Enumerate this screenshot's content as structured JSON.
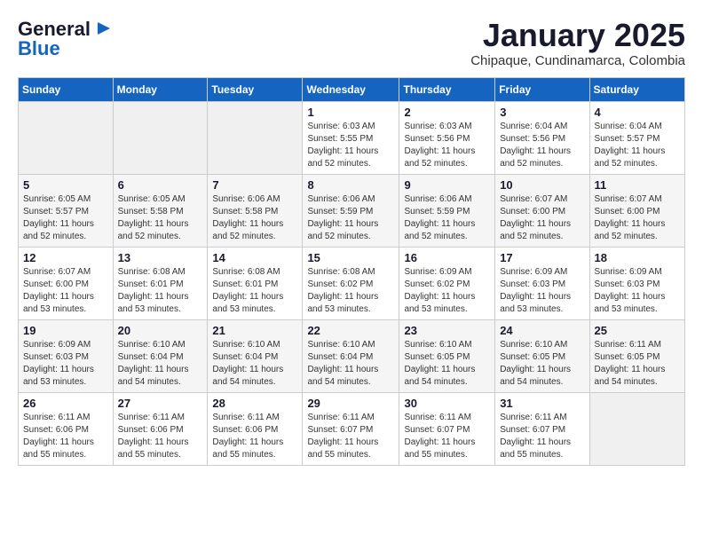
{
  "logo": {
    "general": "General",
    "blue": "Blue"
  },
  "header": {
    "month": "January 2025",
    "location": "Chipaque, Cundinamarca, Colombia"
  },
  "weekdays": [
    "Sunday",
    "Monday",
    "Tuesday",
    "Wednesday",
    "Thursday",
    "Friday",
    "Saturday"
  ],
  "weeks": [
    [
      {
        "day": "",
        "info": ""
      },
      {
        "day": "",
        "info": ""
      },
      {
        "day": "",
        "info": ""
      },
      {
        "day": "1",
        "info": "Sunrise: 6:03 AM\nSunset: 5:55 PM\nDaylight: 11 hours\nand 52 minutes."
      },
      {
        "day": "2",
        "info": "Sunrise: 6:03 AM\nSunset: 5:56 PM\nDaylight: 11 hours\nand 52 minutes."
      },
      {
        "day": "3",
        "info": "Sunrise: 6:04 AM\nSunset: 5:56 PM\nDaylight: 11 hours\nand 52 minutes."
      },
      {
        "day": "4",
        "info": "Sunrise: 6:04 AM\nSunset: 5:57 PM\nDaylight: 11 hours\nand 52 minutes."
      }
    ],
    [
      {
        "day": "5",
        "info": "Sunrise: 6:05 AM\nSunset: 5:57 PM\nDaylight: 11 hours\nand 52 minutes."
      },
      {
        "day": "6",
        "info": "Sunrise: 6:05 AM\nSunset: 5:58 PM\nDaylight: 11 hours\nand 52 minutes."
      },
      {
        "day": "7",
        "info": "Sunrise: 6:06 AM\nSunset: 5:58 PM\nDaylight: 11 hours\nand 52 minutes."
      },
      {
        "day": "8",
        "info": "Sunrise: 6:06 AM\nSunset: 5:59 PM\nDaylight: 11 hours\nand 52 minutes."
      },
      {
        "day": "9",
        "info": "Sunrise: 6:06 AM\nSunset: 5:59 PM\nDaylight: 11 hours\nand 52 minutes."
      },
      {
        "day": "10",
        "info": "Sunrise: 6:07 AM\nSunset: 6:00 PM\nDaylight: 11 hours\nand 52 minutes."
      },
      {
        "day": "11",
        "info": "Sunrise: 6:07 AM\nSunset: 6:00 PM\nDaylight: 11 hours\nand 52 minutes."
      }
    ],
    [
      {
        "day": "12",
        "info": "Sunrise: 6:07 AM\nSunset: 6:00 PM\nDaylight: 11 hours\nand 53 minutes."
      },
      {
        "day": "13",
        "info": "Sunrise: 6:08 AM\nSunset: 6:01 PM\nDaylight: 11 hours\nand 53 minutes."
      },
      {
        "day": "14",
        "info": "Sunrise: 6:08 AM\nSunset: 6:01 PM\nDaylight: 11 hours\nand 53 minutes."
      },
      {
        "day": "15",
        "info": "Sunrise: 6:08 AM\nSunset: 6:02 PM\nDaylight: 11 hours\nand 53 minutes."
      },
      {
        "day": "16",
        "info": "Sunrise: 6:09 AM\nSunset: 6:02 PM\nDaylight: 11 hours\nand 53 minutes."
      },
      {
        "day": "17",
        "info": "Sunrise: 6:09 AM\nSunset: 6:03 PM\nDaylight: 11 hours\nand 53 minutes."
      },
      {
        "day": "18",
        "info": "Sunrise: 6:09 AM\nSunset: 6:03 PM\nDaylight: 11 hours\nand 53 minutes."
      }
    ],
    [
      {
        "day": "19",
        "info": "Sunrise: 6:09 AM\nSunset: 6:03 PM\nDaylight: 11 hours\nand 53 minutes."
      },
      {
        "day": "20",
        "info": "Sunrise: 6:10 AM\nSunset: 6:04 PM\nDaylight: 11 hours\nand 54 minutes."
      },
      {
        "day": "21",
        "info": "Sunrise: 6:10 AM\nSunset: 6:04 PM\nDaylight: 11 hours\nand 54 minutes."
      },
      {
        "day": "22",
        "info": "Sunrise: 6:10 AM\nSunset: 6:04 PM\nDaylight: 11 hours\nand 54 minutes."
      },
      {
        "day": "23",
        "info": "Sunrise: 6:10 AM\nSunset: 6:05 PM\nDaylight: 11 hours\nand 54 minutes."
      },
      {
        "day": "24",
        "info": "Sunrise: 6:10 AM\nSunset: 6:05 PM\nDaylight: 11 hours\nand 54 minutes."
      },
      {
        "day": "25",
        "info": "Sunrise: 6:11 AM\nSunset: 6:05 PM\nDaylight: 11 hours\nand 54 minutes."
      }
    ],
    [
      {
        "day": "26",
        "info": "Sunrise: 6:11 AM\nSunset: 6:06 PM\nDaylight: 11 hours\nand 55 minutes."
      },
      {
        "day": "27",
        "info": "Sunrise: 6:11 AM\nSunset: 6:06 PM\nDaylight: 11 hours\nand 55 minutes."
      },
      {
        "day": "28",
        "info": "Sunrise: 6:11 AM\nSunset: 6:06 PM\nDaylight: 11 hours\nand 55 minutes."
      },
      {
        "day": "29",
        "info": "Sunrise: 6:11 AM\nSunset: 6:07 PM\nDaylight: 11 hours\nand 55 minutes."
      },
      {
        "day": "30",
        "info": "Sunrise: 6:11 AM\nSunset: 6:07 PM\nDaylight: 11 hours\nand 55 minutes."
      },
      {
        "day": "31",
        "info": "Sunrise: 6:11 AM\nSunset: 6:07 PM\nDaylight: 11 hours\nand 55 minutes."
      },
      {
        "day": "",
        "info": ""
      }
    ]
  ]
}
